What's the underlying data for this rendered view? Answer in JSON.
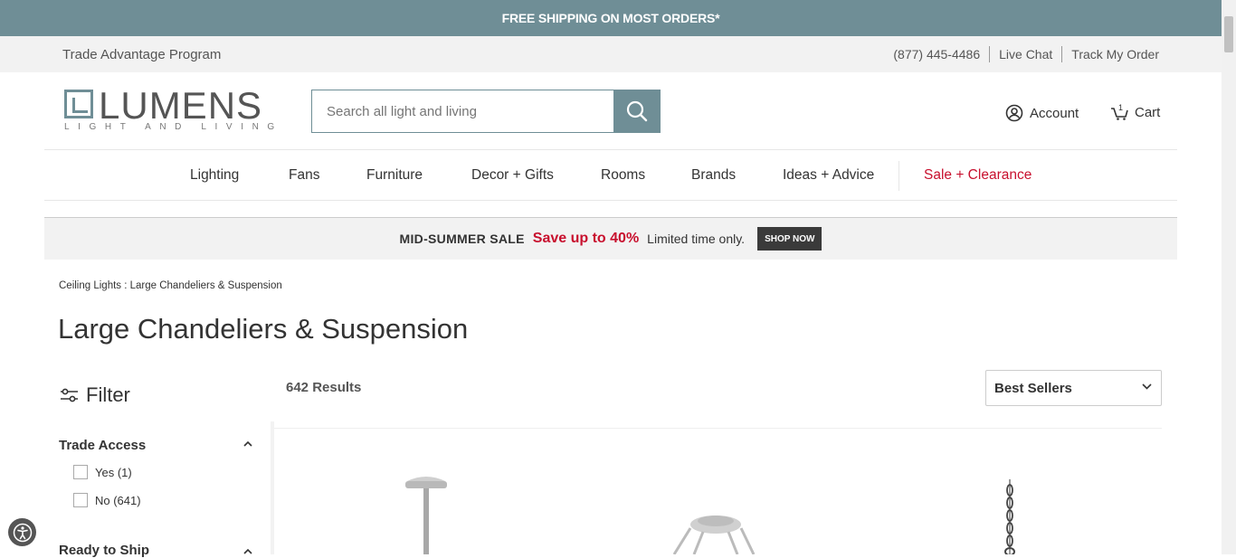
{
  "shipping_banner": "FREE SHIPPING ON MOST ORDERS*",
  "util": {
    "trade_program": "Trade Advantage Program",
    "phone": "(877) 445-4486",
    "live_chat": "Live Chat",
    "track_order": "Track My Order"
  },
  "logo": {
    "name": "LUMENS",
    "tagline": "LIGHT AND LIVING"
  },
  "search": {
    "placeholder": "Search all light and living"
  },
  "header": {
    "account": "Account",
    "cart": "Cart",
    "cart_count": "1"
  },
  "nav": {
    "items": [
      "Lighting",
      "Fans",
      "Furniture",
      "Decor + Gifts",
      "Rooms",
      "Brands",
      "Ideas + Advice"
    ],
    "sale": "Sale + Clearance"
  },
  "promo": {
    "title": "MID-SUMMER SALE",
    "save": "Save up to 40%",
    "limited": "Limited time only.",
    "button": "SHOP NOW"
  },
  "breadcrumb": "Ceiling Lights : Large Chandeliers & Suspension",
  "page_title": "Large Chandeliers & Suspension",
  "filter": {
    "label": "Filter",
    "facets": [
      {
        "title": "Trade Access",
        "options": [
          "Yes (1)",
          "No (641)"
        ]
      },
      {
        "title": "Ready to Ship"
      }
    ]
  },
  "results_count": "642 Results",
  "sort": {
    "selected": "Best Sellers"
  }
}
